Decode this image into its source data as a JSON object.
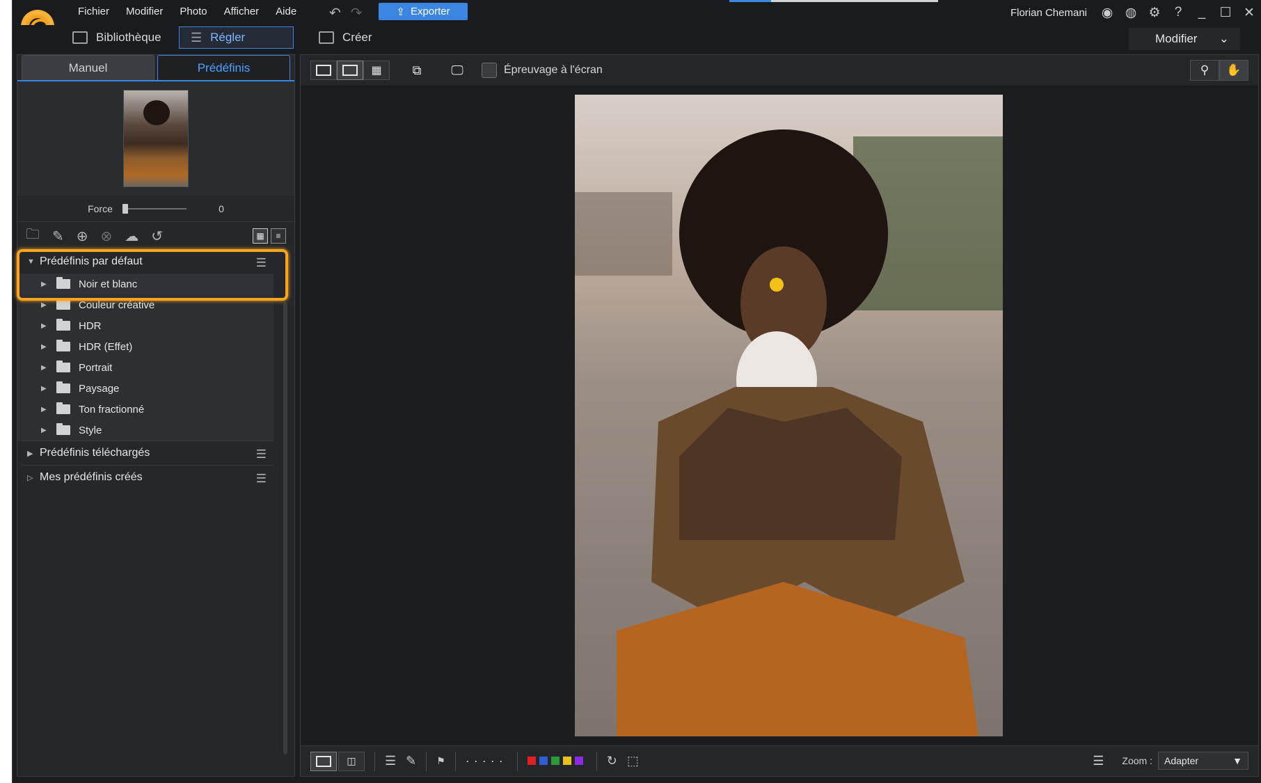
{
  "app": {
    "user": "Florian Chemani"
  },
  "menu": [
    "Fichier",
    "Modifier",
    "Photo",
    "Afficher",
    "Aide"
  ],
  "toolbar": {
    "export_label": "Exporter"
  },
  "modes": {
    "library": "Bibliothèque",
    "adjust": "Régler",
    "create": "Créer",
    "modify": "Modifier"
  },
  "left": {
    "tab_manual": "Manuel",
    "tab_presets": "Prédéfinis",
    "force_label": "Force",
    "force_value": "0",
    "groups": {
      "default": "Prédéfinis par défaut",
      "downloaded": "Prédéfinis téléchargés",
      "mine": "Mes prédéfinis créés"
    },
    "items": [
      "Noir et blanc",
      "Couleur créative",
      "HDR",
      "HDR (Effet)",
      "Portrait",
      "Paysage",
      "Ton fractionné",
      "Style"
    ]
  },
  "view": {
    "proof_label": "Épreuvage à l'écran",
    "zoom_label": "Zoom :",
    "zoom_value": "Adapter"
  },
  "label_colors": [
    "#e02020",
    "#2f5fd0",
    "#2a9a3a",
    "#e8c21a",
    "#8a2be2"
  ],
  "icons": [
    "undo-icon",
    "redo-icon",
    "upload-icon",
    "user-icon",
    "bell-icon",
    "gear-icon",
    "help-icon",
    "minimize-icon",
    "maximize-icon",
    "close-icon",
    "search-icon",
    "hand-icon",
    "rotate-icon"
  ]
}
